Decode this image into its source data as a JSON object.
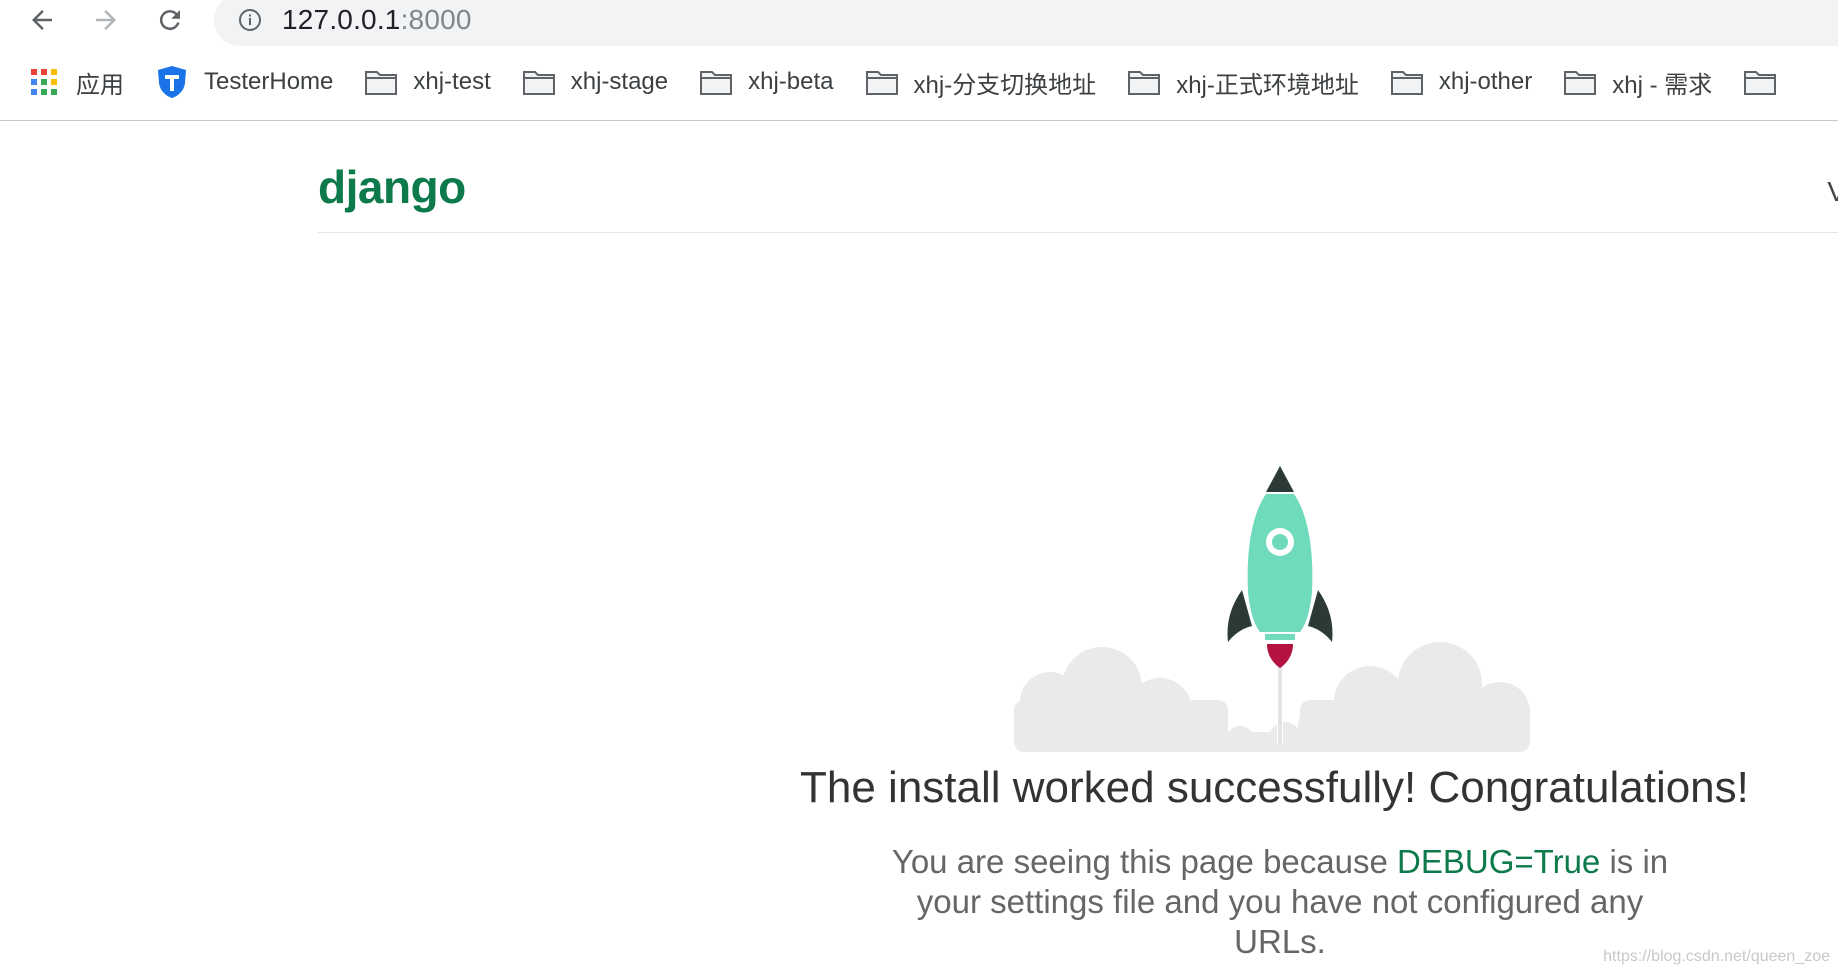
{
  "browser": {
    "url_host": "127.0.0.1",
    "url_port": ":8000",
    "back_icon": "arrow-left-icon",
    "forward_icon": "arrow-right-icon",
    "reload_icon": "reload-icon",
    "info_icon": "info-icon"
  },
  "bookmarks": [
    {
      "label": "应用",
      "icon": "apps-grid-icon"
    },
    {
      "label": "TesterHome",
      "icon": "testerhome-shield-icon"
    },
    {
      "label": "xhj-test",
      "icon": "folder-icon"
    },
    {
      "label": "xhj-stage",
      "icon": "folder-icon"
    },
    {
      "label": "xhj-beta",
      "icon": "folder-icon"
    },
    {
      "label": "xhj-分支切换地址",
      "icon": "folder-icon"
    },
    {
      "label": "xhj-正式环境地址",
      "icon": "folder-icon"
    },
    {
      "label": "xhj-other",
      "icon": "folder-icon"
    },
    {
      "label": "xhj - 需求",
      "icon": "folder-icon"
    }
  ],
  "page": {
    "logo": "django",
    "version_partial": "V",
    "headline": "The install worked successfully! Congratulations!",
    "subtext_before": "You are seeing this page because ",
    "subtext_debug": "DEBUG=True",
    "subtext_after": " is in your settings file and you have not configured any URLs.",
    "watermark": "https://blog.csdn.net/queen_zoe"
  },
  "colors": {
    "django_green": "#0c7a4a",
    "rocket_body": "#6fdbbc",
    "rocket_dark": "#2b3a36",
    "flame": "#b5133f",
    "cloud": "#e9eaec"
  }
}
